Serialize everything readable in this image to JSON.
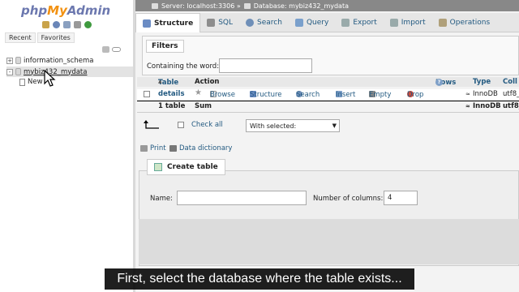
{
  "logo": {
    "php": "php",
    "my": "My",
    "admin": "Admin"
  },
  "colors": {
    "brand_blue": "#6c78af",
    "brand_orange": "#f29111",
    "link": "#235a81"
  },
  "sidebar": {
    "tabs": [
      "Recent",
      "Favorites"
    ],
    "quick_icons": [
      "home-icon",
      "help-icon",
      "docs-icon",
      "settings-icon",
      "reload-icon"
    ],
    "tree": [
      {
        "expander": "+",
        "label": "information_schema"
      },
      {
        "expander": "-",
        "label": "mybiz432_mydata"
      }
    ],
    "new_item_label": "New"
  },
  "breadcrumb": {
    "server": "Server: localhost:3306 »",
    "database": "Database: mybiz432_mydata"
  },
  "tabs": [
    {
      "label": "Structure",
      "icon": "structure-icon",
      "active": true
    },
    {
      "label": "SQL",
      "icon": "sql-icon"
    },
    {
      "label": "Search",
      "icon": "search-icon"
    },
    {
      "label": "Query",
      "icon": "query-icon"
    },
    {
      "label": "Export",
      "icon": "export-icon"
    },
    {
      "label": "Import",
      "icon": "import-icon"
    },
    {
      "label": "Operations",
      "icon": "wrench-icon"
    }
  ],
  "filters": {
    "legend": "Filters",
    "label": "Containing the word:",
    "value": ""
  },
  "table": {
    "headers": {
      "table": "Table",
      "action": "Action",
      "rows": "Rows",
      "type": "Type",
      "collation": "Coll"
    },
    "rows": [
      {
        "name": "details",
        "actions": [
          "Browse",
          "Structure",
          "Search",
          "Insert",
          "Empty",
          "Drop"
        ],
        "rows": "≈",
        "type": "InnoDB",
        "collation": "utf8_"
      }
    ],
    "summary": {
      "name": "1 table",
      "action": "Sum",
      "rows": "≈",
      "type": "InnoDB",
      "collation": "utf8_"
    }
  },
  "bulk": {
    "check_all": "Check all",
    "with_selected": "With selected:"
  },
  "links": {
    "print": "Print",
    "data_dictionary": "Data dictionary"
  },
  "create_table": {
    "legend": "Create table",
    "name_label": "Name:",
    "name_value": "",
    "columns_label": "Number of columns:",
    "columns_value": "4"
  },
  "subtitle": "First, select the database where the table exists..."
}
